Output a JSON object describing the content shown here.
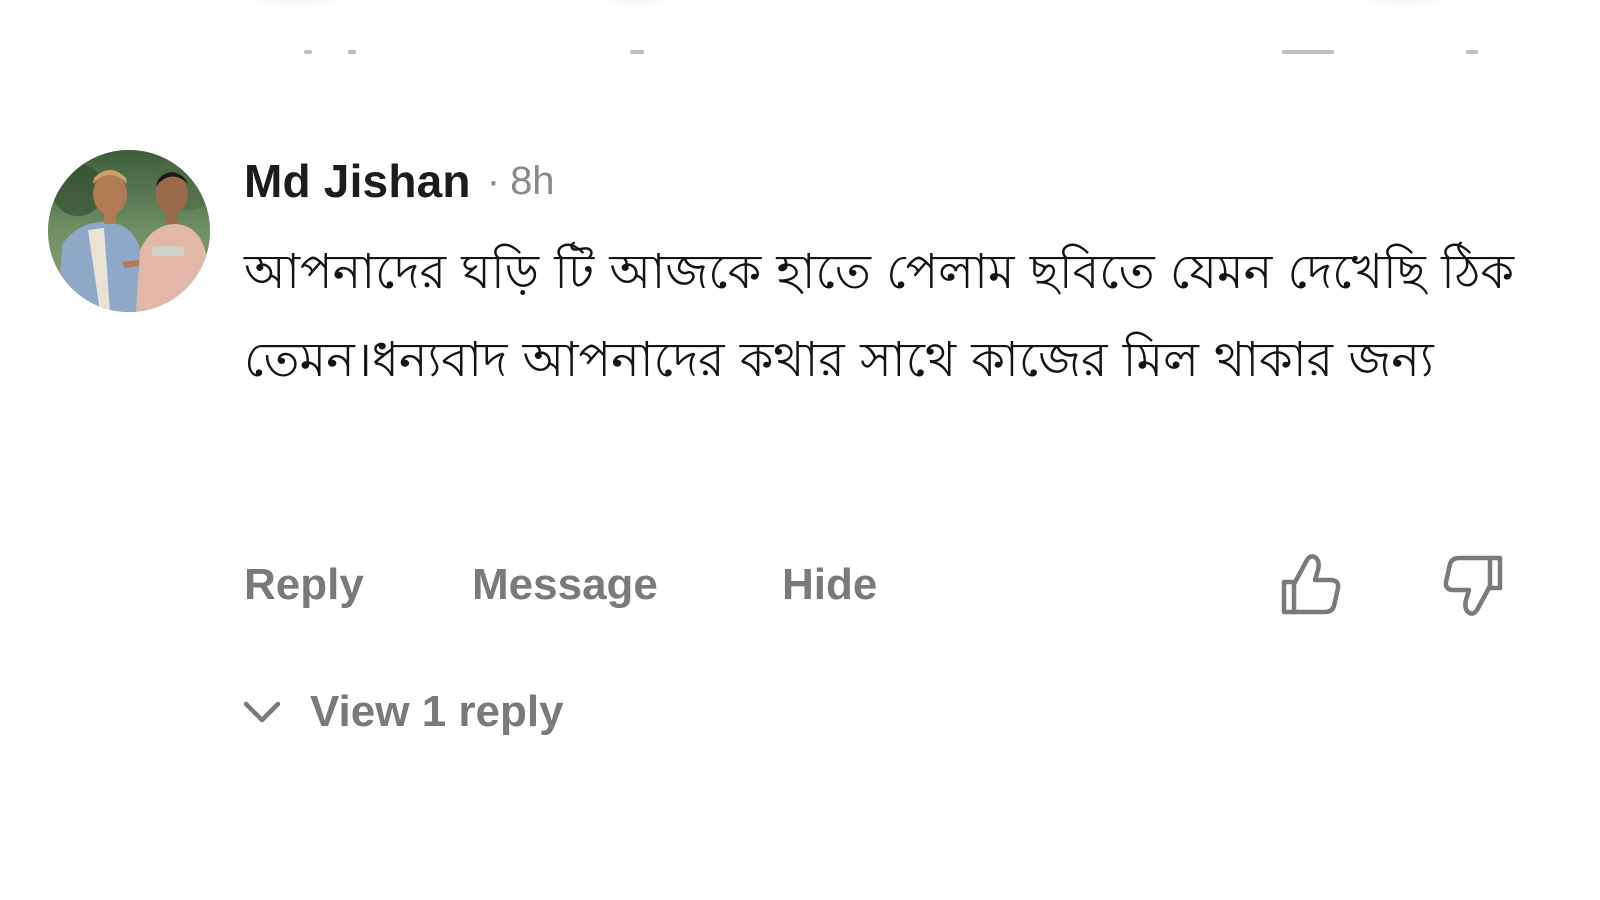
{
  "comment": {
    "author": "Md Jishan",
    "separator": "·",
    "time": "8h",
    "text": "আপনাদের ঘড়ি টি আজকে হাতে পেলাম ছবিতে যেমন দেখেছি ঠিক তেমন।ধন্যবাদ আপনাদের কথার সাথে কাজের মিল থাকার জন্য",
    "avatar_icon": "avatar-photo",
    "actions": {
      "reply_label": "Reply",
      "message_label": "Message",
      "hide_label": "Hide",
      "like_icon": "thumbs-up-icon",
      "dislike_icon": "thumbs-down-icon"
    },
    "replies": {
      "label": "View 1 reply",
      "icon": "chevron-down-icon"
    }
  },
  "colors": {
    "text_primary": "#141414",
    "text_secondary": "#7a7a7a",
    "background": "#ffffff"
  }
}
